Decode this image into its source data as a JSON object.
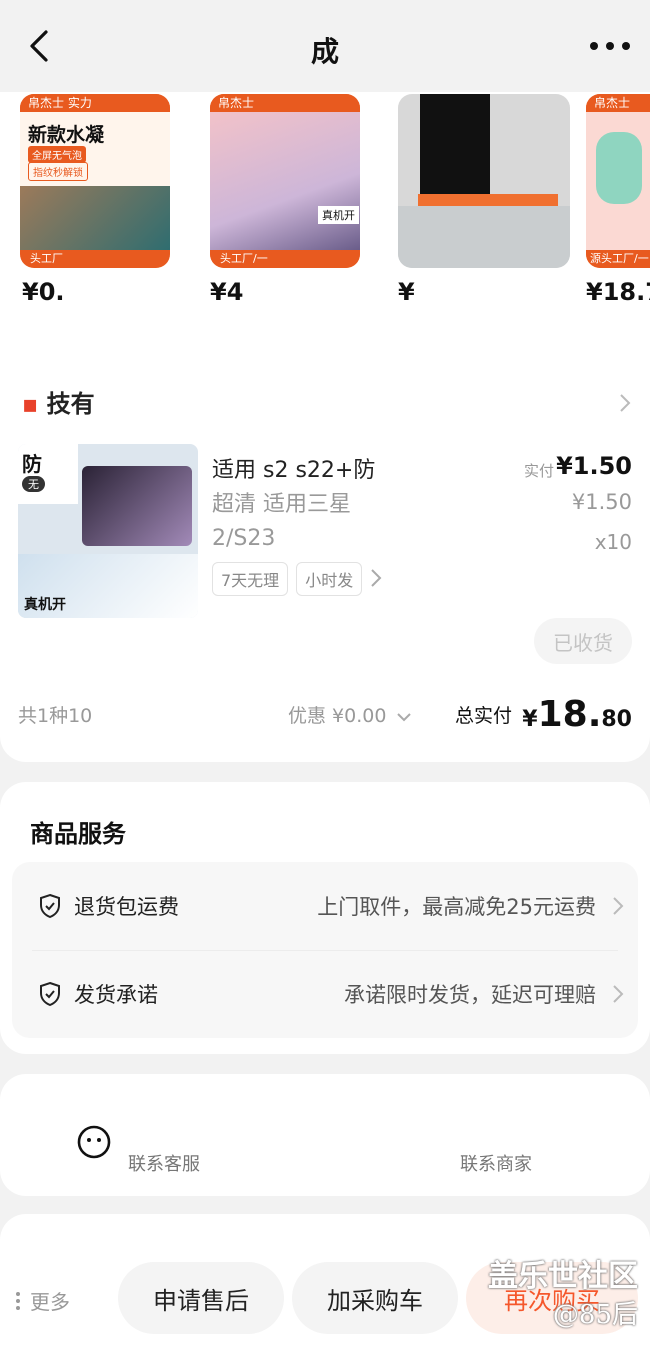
{
  "header": {
    "title": "成",
    "back_icon": "chevron-left-icon",
    "more_icon": "ellipsis-icon"
  },
  "recommend": {
    "items": [
      {
        "banner_top": "帛杰士",
        "banner_sub": "实力",
        "headline": "新款水凝",
        "pill1": "全屏无气泡",
        "pill2": "指纹秒解锁",
        "bottom": "头工厂",
        "price": "¥0."
      },
      {
        "banner_top": "帛杰士",
        "headline": "",
        "pill1": "真机开",
        "bottom": "头工厂/一",
        "price": "¥4"
      },
      {
        "price": "¥"
      },
      {
        "banner_top": "帛杰士",
        "bottom": "源头工厂/一",
        "price": "¥18.7"
      }
    ]
  },
  "order": {
    "shop_name": "技有",
    "product": {
      "thumb_tag": "防",
      "thumb_tag2": "无",
      "thumb_footer": "真机开",
      "name_line1": "适用 s2 s22+防",
      "name_line2": "超清 适用三星",
      "name_line3": "2/S23",
      "paid_label": "实付",
      "price": "¥1.50",
      "original_price": "¥1.50",
      "qty": "x10",
      "tags": [
        "7天无理",
        "小时发"
      ]
    },
    "status_button": "已收货",
    "count_text": "共1种10",
    "discount_text": "优惠 ¥0.00",
    "total_label": "总实付",
    "total_symbol": "¥",
    "total_int": "18.",
    "total_dec": "80"
  },
  "services": {
    "title": "商品服务",
    "rows": [
      {
        "icon": "shield-check-icon",
        "key": "退货包运费",
        "value": "上门取件，最高减免25元运费"
      },
      {
        "icon": "shield-check-icon",
        "key": "发货承诺",
        "value": "承诺限时发货，延迟可理赔"
      }
    ]
  },
  "contact": {
    "left_label": "联系客服",
    "right_label": "联系商家",
    "left_icon": "customer-service-icon"
  },
  "bottom_bar": {
    "more_label": "更多",
    "after_sale": "申请售后",
    "add_cart": "加采购车",
    "buy_again": "再次购买"
  },
  "watermark": {
    "line1": "盖乐世社区",
    "line2": "@85后"
  },
  "colors": {
    "accent": "#f5572b",
    "recommend_orange": "#f47a35",
    "background": "#f2f2f2"
  }
}
